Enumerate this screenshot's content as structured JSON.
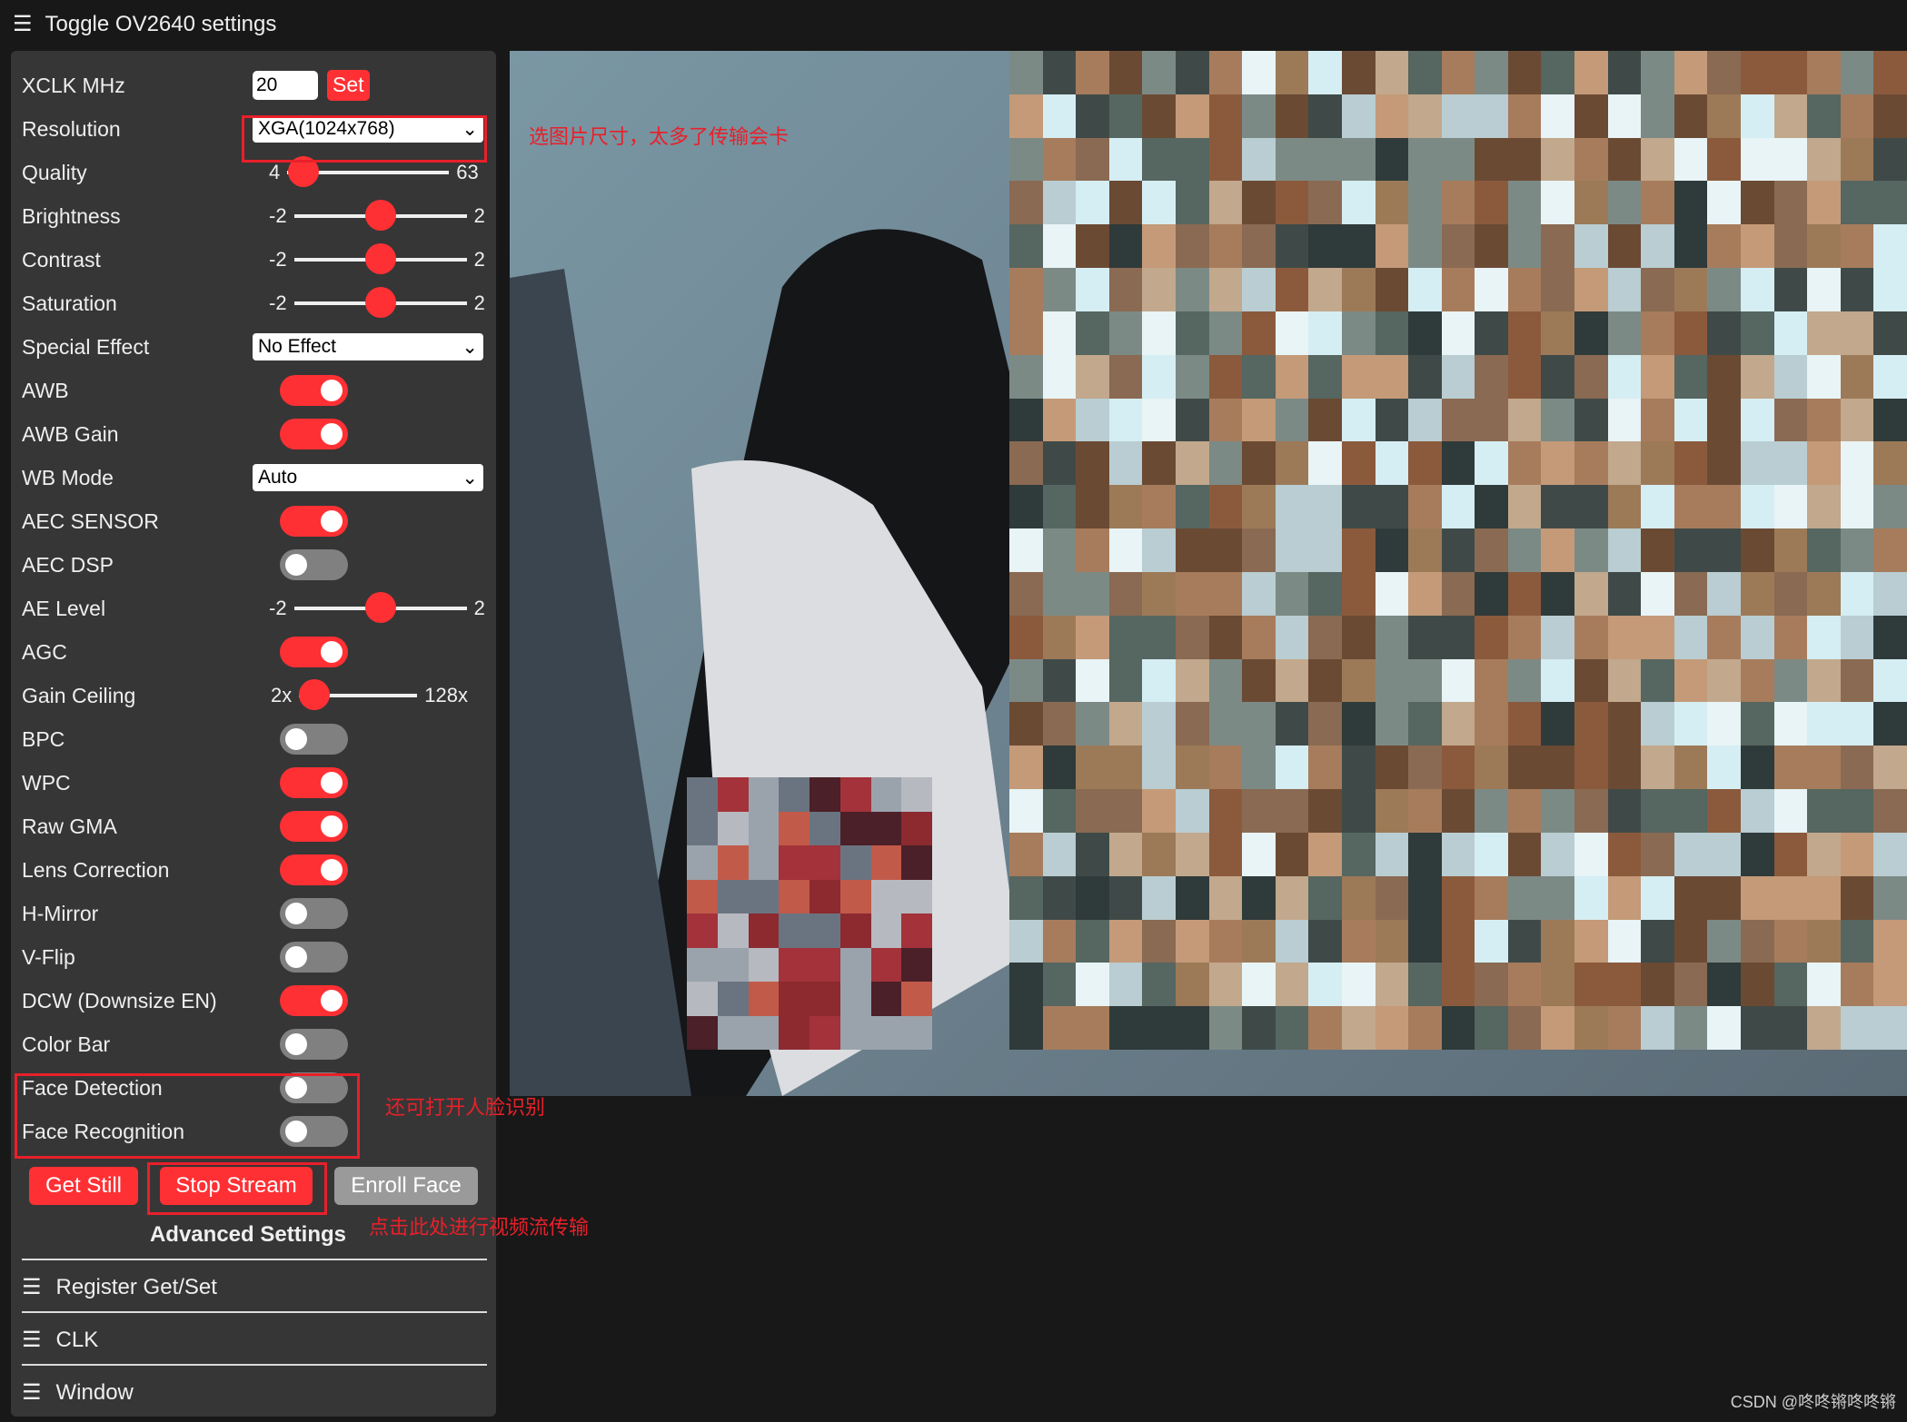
{
  "header": {
    "title": "Toggle OV2640 settings",
    "icon": "hamburger-icon"
  },
  "settings": {
    "xclk": {
      "label": "XCLK MHz",
      "value": "20",
      "button": "Set"
    },
    "resolution": {
      "label": "Resolution",
      "value": "XGA(1024x768)"
    },
    "quality": {
      "label": "Quality",
      "min": "4",
      "max": "63",
      "value": 10
    },
    "brightness": {
      "label": "Brightness",
      "min": "-2",
      "max": "2",
      "value": 0
    },
    "contrast": {
      "label": "Contrast",
      "min": "-2",
      "max": "2",
      "value": 0
    },
    "saturation": {
      "label": "Saturation",
      "min": "-2",
      "max": "2",
      "value": 0
    },
    "special_effect": {
      "label": "Special Effect",
      "value": "No Effect"
    },
    "awb": {
      "label": "AWB",
      "on": true
    },
    "awb_gain": {
      "label": "AWB Gain",
      "on": true
    },
    "wb_mode": {
      "label": "WB Mode",
      "value": "Auto"
    },
    "aec_sensor": {
      "label": "AEC SENSOR",
      "on": true
    },
    "aec_dsp": {
      "label": "AEC DSP",
      "on": false
    },
    "ae_level": {
      "label": "AE Level",
      "min": "-2",
      "max": "2",
      "value": 0
    },
    "agc": {
      "label": "AGC",
      "on": true
    },
    "gain_ceiling": {
      "label": "Gain Ceiling",
      "min": "2x",
      "max": "128x",
      "value": 0
    },
    "bpc": {
      "label": "BPC",
      "on": false
    },
    "wpc": {
      "label": "WPC",
      "on": true
    },
    "raw_gma": {
      "label": "Raw GMA",
      "on": true
    },
    "lens_correction": {
      "label": "Lens Correction",
      "on": true
    },
    "hmirror": {
      "label": "H-Mirror",
      "on": false
    },
    "vflip": {
      "label": "V-Flip",
      "on": false
    },
    "dcw": {
      "label": "DCW (Downsize EN)",
      "on": true
    },
    "colorbar": {
      "label": "Color Bar",
      "on": false
    },
    "face_detect": {
      "label": "Face Detection",
      "on": false
    },
    "face_recognize": {
      "label": "Face Recognition",
      "on": false
    }
  },
  "buttons": {
    "get_still": "Get Still",
    "stop_stream": "Stop Stream",
    "enroll_face": "Enroll Face"
  },
  "advanced": {
    "title": "Advanced Settings",
    "items": [
      "Register Get/Set",
      "CLK",
      "Window"
    ]
  },
  "annotations": {
    "resolution": "选图片尺寸，太多了传输会卡",
    "face": "还可打开人脸识别",
    "stream": "点击此处进行视频流传输"
  },
  "watermark": "CSDN @咚咚锵咚咚锵",
  "colors": {
    "accent": "#ff3034",
    "panel": "#363636",
    "annotation": "#e8202a"
  }
}
